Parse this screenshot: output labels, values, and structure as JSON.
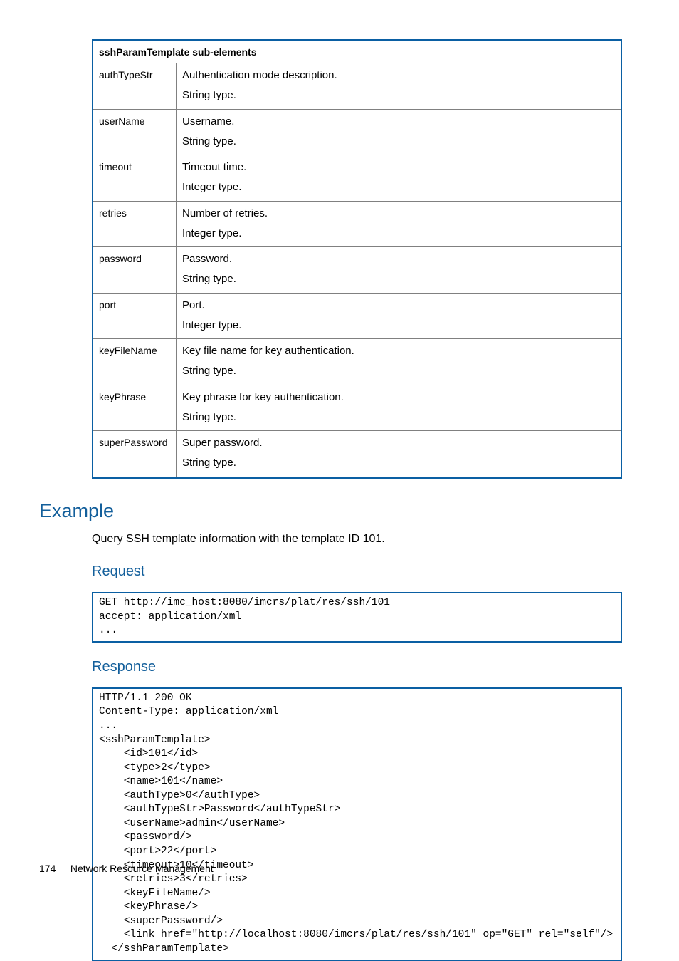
{
  "table": {
    "header": "sshParamTemplate sub-elements",
    "rows": [
      {
        "name": "authTypeStr",
        "l1": "Authentication mode description.",
        "l2": "String type."
      },
      {
        "name": "userName",
        "l1": "Username.",
        "l2": "String type."
      },
      {
        "name": "timeout",
        "l1": "Timeout time.",
        "l2": "Integer type."
      },
      {
        "name": "retries",
        "l1": "Number of retries.",
        "l2": "Integer type."
      },
      {
        "name": "password",
        "l1": "Password.",
        "l2": "String type."
      },
      {
        "name": "port",
        "l1": "Port.",
        "l2": "Integer type."
      },
      {
        "name": "keyFileName",
        "l1": "Key file name for key authentication.",
        "l2": "String type."
      },
      {
        "name": "keyPhrase",
        "l1": "Key phrase for key authentication.",
        "l2": "String type."
      },
      {
        "name": "superPassword",
        "l1": "Super password.",
        "l2": "String type."
      }
    ]
  },
  "example_heading": "Example",
  "example_intro": "Query SSH template information with the template ID 101.",
  "request_heading": "Request",
  "request_code": "GET http://imc_host:8080/imcrs/plat/res/ssh/101\naccept: application/xml\n...",
  "response_heading": "Response",
  "response_code": "HTTP/1.1 200 OK\nContent-Type: application/xml\n...\n<sshParamTemplate>\n    <id>101</id>\n    <type>2</type>\n    <name>101</name>\n    <authType>0</authType>\n    <authTypeStr>Password</authTypeStr>\n    <userName>admin</userName>\n    <password/>\n    <port>22</port>\n    <timeout>10</timeout>\n    <retries>3</retries>\n    <keyFileName/>\n    <keyPhrase/>\n    <superPassword/>\n    <link href=\"http://localhost:8080/imcrs/plat/res/ssh/101\" op=\"GET\" rel=\"self\"/>\n  </sshParamTemplate>",
  "footer": {
    "page": "174",
    "section": "Network Resource Management"
  }
}
